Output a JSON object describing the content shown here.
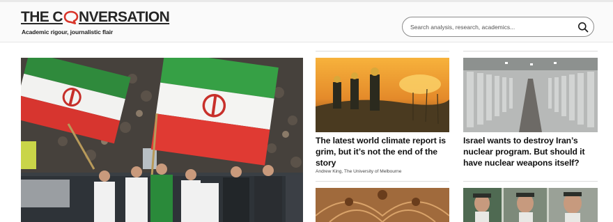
{
  "site": {
    "logo_left": "THE C",
    "logo_right": "NVERSATION",
    "tagline": "Academic rigour, journalistic flair"
  },
  "search": {
    "placeholder": "Search analysis, research, academics..."
  },
  "hero": {
    "image": "iran-football-fans-flags-photo"
  },
  "articles": [
    {
      "image": "firefighters-bushfire-photo",
      "headline": "The latest world climate report is grim, but it’s not the end of the story",
      "byline": "Andrew King, The University of Melbourne"
    },
    {
      "image": "centrifuge-hall-photo",
      "headline": "Israel wants to destroy Iran’s nuclear program. But should it have nuclear weapons itself?",
      "byline": ""
    },
    {
      "image": "ornate-ceiling-photo"
    },
    {
      "image": "leaders-billboard-photo"
    }
  ],
  "colors": {
    "brand_red": "#d8352a",
    "text": "#1a1a1a"
  }
}
